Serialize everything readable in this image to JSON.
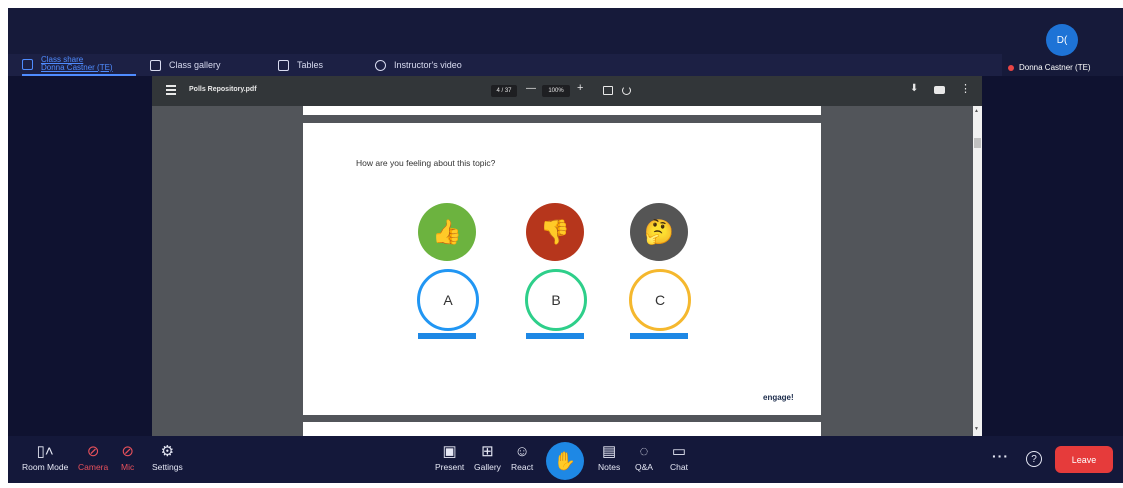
{
  "tabs": [
    {
      "label_line1": "Class share",
      "label_line2": "Donna Castner (TE)"
    },
    {
      "label": "Class gallery"
    },
    {
      "label": "Tables"
    },
    {
      "label": "Instructor's video"
    }
  ],
  "participant": {
    "initials": "D(",
    "name": "Donna Castner (TE)"
  },
  "pdf": {
    "filename": "Polls Repository.pdf",
    "page_indicator": "4 / 37",
    "zoom": "100%",
    "zoom_minus": "—",
    "zoom_plus": "+"
  },
  "slide": {
    "question": "How are you feeling about this topic?",
    "choices": [
      {
        "emoji": "👍",
        "letter": "A",
        "circle_color": "#6cb33f",
        "ring_color": "#2196f3"
      },
      {
        "emoji": "👎",
        "letter": "B",
        "circle_color": "#b6361c",
        "ring_color": "#2ecf8a"
      },
      {
        "emoji": "🤔",
        "letter": "C",
        "circle_color": "#555555",
        "ring_color": "#f5b82e"
      }
    ],
    "brand": "engage!"
  },
  "bottom_bar": {
    "room_mode": "Room Mode",
    "camera": "Camera",
    "mic": "Mic",
    "settings": "Settings",
    "present": "Present",
    "gallery": "Gallery",
    "react": "React",
    "notes": "Notes",
    "qa": "Q&A",
    "chat": "Chat",
    "more": "···",
    "help": "?",
    "leave": "Leave"
  },
  "colors": {
    "accent": "#1e88e5",
    "leave": "#e63b3b",
    "muted_red": "#e9515b",
    "background": "#0f1230"
  }
}
